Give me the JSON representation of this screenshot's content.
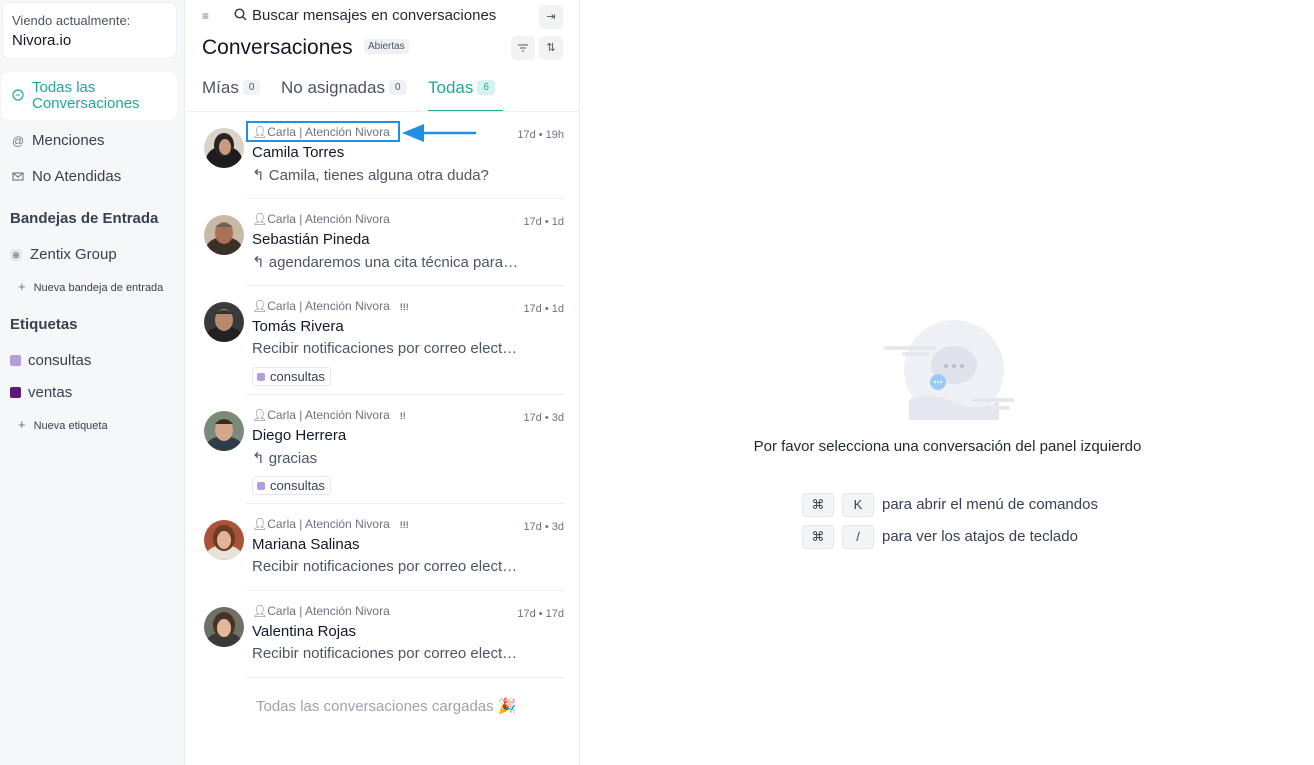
{
  "sidebar": {
    "account_label": "Viendo actualmente:",
    "account_name": "Nivora.io",
    "nav": [
      {
        "label": "Todas las Conversaciones",
        "icon": "chat-bubble-icon"
      },
      {
        "label": "Menciones",
        "icon": "at-icon"
      },
      {
        "label": "No Atendidas",
        "icon": "mail-open-icon"
      }
    ],
    "inboxes_title": "Bandejas de Entrada",
    "inbox": "Zentix Group",
    "new_inbox": "Nueva bandeja de entrada",
    "labels_title": "Etiquetas",
    "labels": [
      {
        "name": "consultas",
        "color": "#b39ddb"
      },
      {
        "name": "ventas",
        "color": "#5b1a7a"
      }
    ],
    "new_label": "Nueva etiqueta"
  },
  "list": {
    "search_placeholder": "Buscar mensajes en conversaciones",
    "title": "Conversaciones",
    "status_badge": "Abiertas",
    "tabs": [
      {
        "label": "Mías",
        "count": "0"
      },
      {
        "label": "No asignadas",
        "count": "0"
      },
      {
        "label": "Todas",
        "count": "6"
      }
    ],
    "conversations": [
      {
        "agent": "Carla | Atención Nivora",
        "priority": "",
        "name": "Camila Torres",
        "time": "17d • 19h",
        "message": "Camila, tienes alguna otra duda?",
        "reply": true,
        "label": ""
      },
      {
        "agent": "Carla | Atención Nivora",
        "priority": "",
        "name": "Sebastián Pineda",
        "time": "17d • 1d",
        "message": "agendaremos una cita técnica para revisar",
        "reply": true,
        "label": ""
      },
      {
        "agent": "Carla | Atención Nivora",
        "priority": "!!!",
        "name": "Tomás Rivera",
        "time": "17d • 1d",
        "message": "Recibir notificaciones por correo electrónico",
        "reply": false,
        "label": "consultas"
      },
      {
        "agent": "Carla | Atención Nivora",
        "priority": "!!",
        "name": "Diego Herrera",
        "time": "17d • 3d",
        "message": "gracias",
        "reply": true,
        "label": "consultas"
      },
      {
        "agent": "Carla | Atención Nivora",
        "priority": "!!!",
        "name": "Mariana Salinas",
        "time": "17d • 3d",
        "message": "Recibir notificaciones por correo electrónico",
        "reply": false,
        "label": ""
      },
      {
        "agent": "Carla | Atención Nivora",
        "priority": "",
        "name": "Valentina Rojas",
        "time": "17d • 17d",
        "message": "Recibir notificaciones por correo electrónico",
        "reply": false,
        "label": ""
      }
    ],
    "loaded_text": "Todas las conversaciones cargadas 🎉"
  },
  "empty_state": {
    "text": "Por favor selecciona una conversación del panel izquierdo",
    "shortcuts": [
      {
        "keys": [
          "⌘",
          "K"
        ],
        "text": "para abrir el menú de comandos"
      },
      {
        "keys": [
          "⌘",
          "/"
        ],
        "text": "para ver los atajos de teclado"
      }
    ]
  },
  "colors": {
    "accent": "#1fa89a",
    "annotation": "#1f8fe8"
  }
}
